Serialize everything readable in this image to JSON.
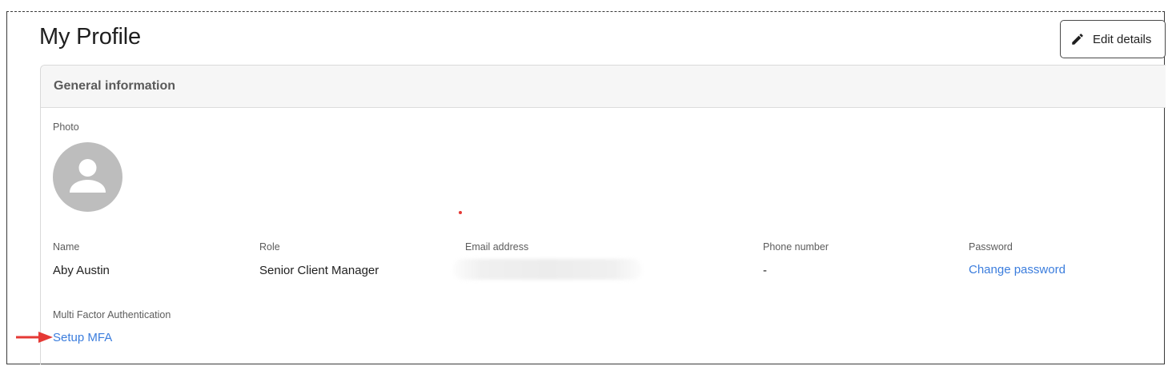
{
  "page": {
    "title": "My Profile"
  },
  "toolbar": {
    "edit_label": "Edit details"
  },
  "card": {
    "header": "General information"
  },
  "profile": {
    "photo_label": "Photo",
    "name_label": "Name",
    "name_value": "Aby Austin",
    "role_label": "Role",
    "role_value": "Senior Client Manager",
    "email_label": "Email address",
    "phone_label": "Phone number",
    "phone_value": "-",
    "password_label": "Password",
    "password_link": "Change password",
    "mfa_label": "Multi Factor Authentication",
    "mfa_link": "Setup MFA"
  },
  "icons": {
    "edit": "pencil-icon",
    "avatar": "user-placeholder-icon",
    "annotation": "red-arrow-icon"
  },
  "colors": {
    "link": "#3b7ddd",
    "avatar_bg": "#bdbdbd",
    "arrow": "#e53935",
    "header_bg": "#f6f6f6"
  }
}
